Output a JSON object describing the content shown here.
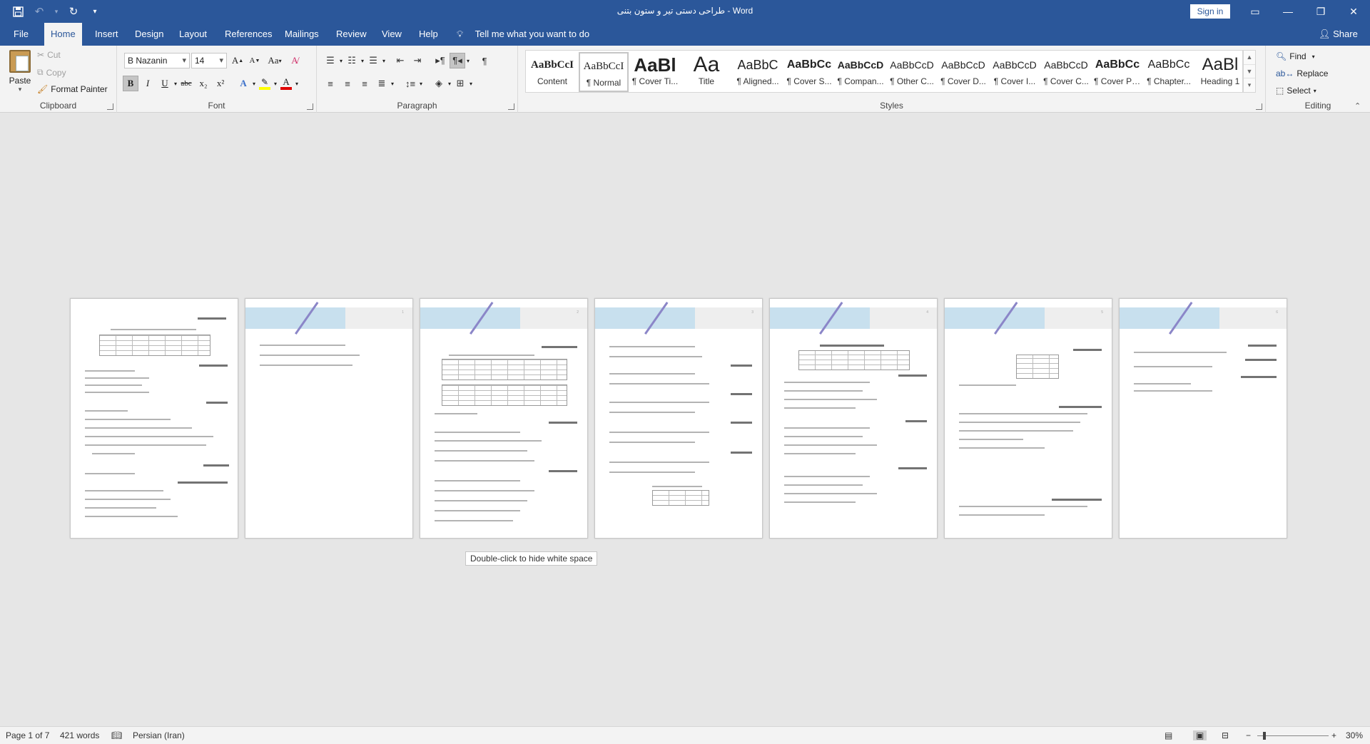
{
  "window": {
    "title": "طراحی دستی تیر و ستون بتنی  -  Word",
    "sign_in": "Sign in",
    "minimize_glyph": "—",
    "restore_glyph": "❐",
    "close_glyph": "✕",
    "ribbon_display_glyph": "▭"
  },
  "qat": {
    "save_icon": "save-icon",
    "undo_icon": "undo-icon",
    "redo_icon": "redo-icon",
    "customize_icon": "chevron-down-icon"
  },
  "tabs": [
    {
      "label": "File"
    },
    {
      "label": "Home"
    },
    {
      "label": "Insert"
    },
    {
      "label": "Design"
    },
    {
      "label": "Layout"
    },
    {
      "label": "References"
    },
    {
      "label": "Mailings"
    },
    {
      "label": "Review"
    },
    {
      "label": "View"
    },
    {
      "label": "Help"
    }
  ],
  "tell_me": "Tell me what you want to do",
  "share": "Share",
  "clipboard": {
    "group_label": "Clipboard",
    "paste": "Paste",
    "cut": "Cut",
    "copy": "Copy",
    "format_painter": "Format Painter"
  },
  "font": {
    "group_label": "Font",
    "font_name": "B Nazanin",
    "font_size": "14",
    "grow": "A",
    "shrink": "A",
    "change_case": "Aa",
    "bold": "B",
    "italic": "I",
    "underline": "U",
    "strikethrough": "abc",
    "subscript": "x₂",
    "superscript": "x²",
    "text_effects": "A",
    "font_color": "A",
    "highlight_color": "#ffff00",
    "font_color_value": "#e00000"
  },
  "paragraph": {
    "group_label": "Paragraph",
    "show_marks": "¶"
  },
  "styles": {
    "group_label": "Styles",
    "items": [
      {
        "sample": "AaBbCcI",
        "name": "Content"
      },
      {
        "sample": "AaBbCcI",
        "name": "¶ Normal"
      },
      {
        "sample": "AaBl",
        "name": "¶ Cover Ti..."
      },
      {
        "sample": "Aa",
        "name": "Title"
      },
      {
        "sample": "AaBbC",
        "name": "¶ Aligned..."
      },
      {
        "sample": "AaBbCc",
        "name": "¶ Cover S..."
      },
      {
        "sample": "AaBbCcD",
        "name": "¶ Compan..."
      },
      {
        "sample": "AaBbCcD",
        "name": "¶ Other C..."
      },
      {
        "sample": "AaBbCcD",
        "name": "¶ Cover D..."
      },
      {
        "sample": "AaBbCcD",
        "name": "¶ Cover I..."
      },
      {
        "sample": "AaBbCcD",
        "name": "¶ Cover C..."
      },
      {
        "sample": "AaBbCc",
        "name": "¶ Cover Pr..."
      },
      {
        "sample": "AaBbCc",
        "name": "¶ Chapter..."
      },
      {
        "sample": "AaBl",
        "name": "Heading 1"
      }
    ]
  },
  "editing": {
    "group_label": "Editing",
    "find": "Find",
    "replace": "Replace",
    "select": "Select"
  },
  "document": {
    "hint": "Double-click to hide white space",
    "page_numbers": [
      "",
      "1",
      "2",
      "3",
      "4",
      "5",
      "6"
    ]
  },
  "status": {
    "page": "Page 1 of 7",
    "words": "421 words",
    "language": "Persian (Iran)",
    "zoom": "30%",
    "zoom_out": "−",
    "zoom_in": "+"
  }
}
